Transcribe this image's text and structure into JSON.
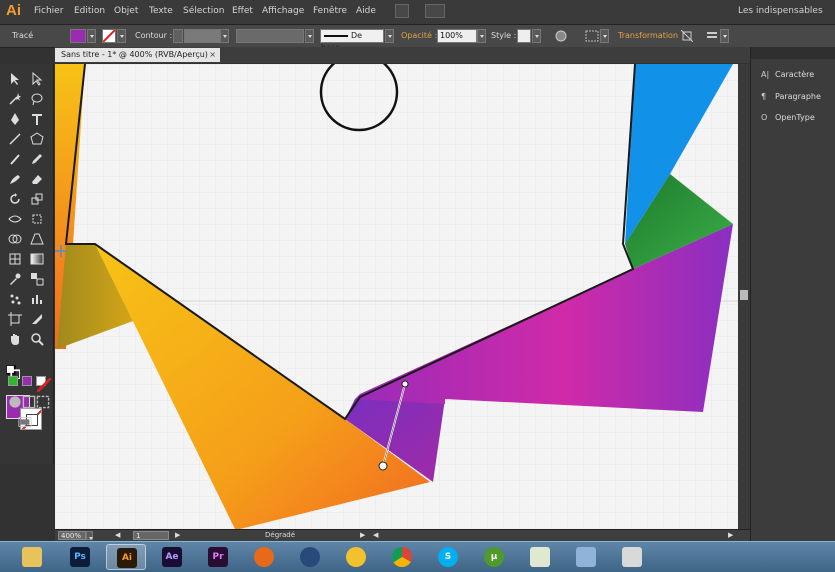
{
  "app": {
    "logo": "Ai",
    "menus": [
      "Fichier",
      "Edition",
      "Objet",
      "Texte",
      "Sélection",
      "Effet",
      "Affichage",
      "Fenêtre",
      "Aide"
    ],
    "workspace": "Les indispensables"
  },
  "control_bar": {
    "selection_label": "Tracé",
    "contour_label": "Contour :",
    "stroke_style": "De base",
    "opacity_label": "Opacité :",
    "opacity_value": "100%",
    "style_label": "Style :",
    "transform_label": "Transformation"
  },
  "document": {
    "tab_title": "Sans titre - 1* @ 400% (RVB/Aperçu)",
    "close_glyph": "×"
  },
  "statusbar": {
    "zoom": "400%",
    "page": "1",
    "tool": "Dégradé"
  },
  "panels": [
    {
      "icon": "A|",
      "label": "Caractère"
    },
    {
      "icon": "¶",
      "label": "Paragraphe"
    },
    {
      "icon": "O",
      "label": "OpenType"
    }
  ],
  "colors": {
    "fill": "#9b2bb0",
    "accent": "#f49c2a",
    "purple": "#8a2fc0",
    "magenta": "#d02aa8",
    "blue": "#1192e8",
    "green": "#2a9a3a",
    "orange": "#f26a21",
    "yellow": "#f7c316"
  },
  "taskbar": {
    "apps": [
      {
        "name": "explorer",
        "label": ""
      },
      {
        "name": "photoshop",
        "label": "Ps"
      },
      {
        "name": "illustrator",
        "label": "Ai",
        "active": true
      },
      {
        "name": "after-effects",
        "label": "Ae"
      },
      {
        "name": "premiere",
        "label": "Pr"
      },
      {
        "name": "firefox",
        "label": ""
      },
      {
        "name": "cinema4d",
        "label": ""
      },
      {
        "name": "media-player",
        "label": ""
      },
      {
        "name": "chrome",
        "label": ""
      },
      {
        "name": "skype",
        "label": "S"
      },
      {
        "name": "utorrent",
        "label": "µ"
      },
      {
        "name": "chart-app",
        "label": ""
      },
      {
        "name": "screen-app",
        "label": ""
      },
      {
        "name": "tool-app",
        "label": ""
      }
    ]
  }
}
